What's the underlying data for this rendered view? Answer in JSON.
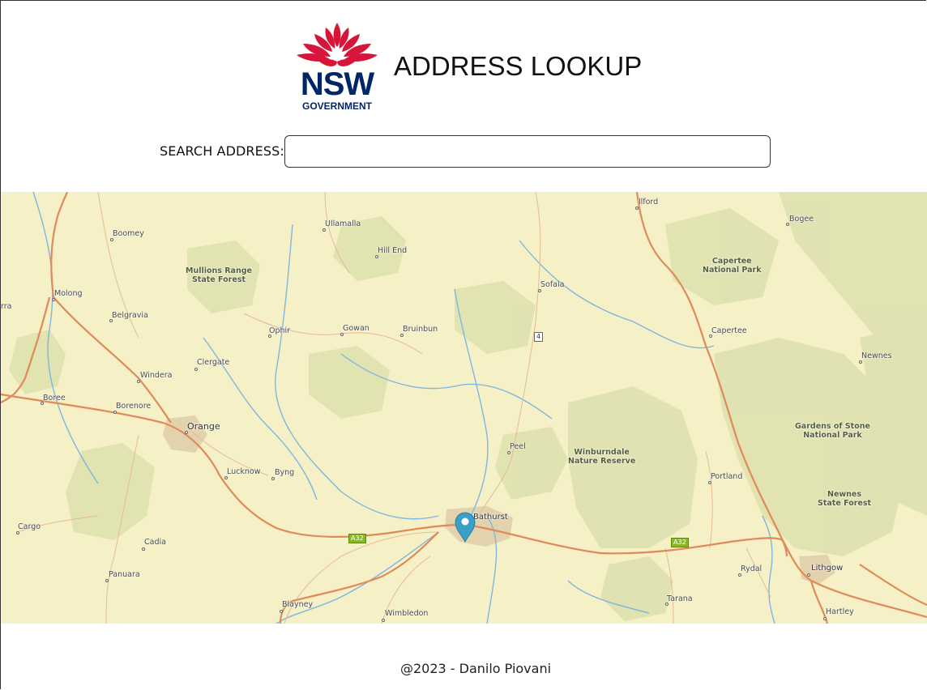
{
  "header": {
    "logo": {
      "wordmark": "NSW",
      "subtext": "GOVERNMENT",
      "icon": "waratah-flower-icon"
    },
    "title": "ADDRESS LOOKUP"
  },
  "search": {
    "label": "SEARCH ADDRESS:",
    "value": "",
    "placeholder": ""
  },
  "map": {
    "marker": "map-pin-icon",
    "places": [
      "Boomey",
      "Ullamalla",
      "Hill End",
      "Bogee",
      "llford",
      "Molong",
      "Belgravia",
      "Ophir",
      "Gowan",
      "Bruinbun",
      "Sofala",
      "Capertee",
      "Newnes",
      "Clergate",
      "Windera",
      "Borenore",
      "Boree",
      "Orange",
      "Lucknow",
      "Byng",
      "Peel",
      "Portland",
      "Bathurst",
      "Cargo",
      "Cadia",
      "Panuara",
      "Rydal",
      "Lithgow",
      "Blayney",
      "Wimbledon",
      "Tarana",
      "Hartley",
      "rra"
    ],
    "parks": [
      "Mullions Range\nState Forest",
      "Capertee\nNational Park",
      "Winburndale\nNature Reserve",
      "Gardens of Stone\nNational Park",
      "Newnes\nState Forest"
    ],
    "road_shields": [
      "A32",
      "A32",
      "4"
    ],
    "colors": {
      "land": "#f5f0c6",
      "forest": "#dfe2b0",
      "road": "#e08a5a",
      "water": "#7fb6e0",
      "marker": "#3ba0c8"
    }
  },
  "footer": {
    "text": "@2023 - Danilo Piovani"
  }
}
